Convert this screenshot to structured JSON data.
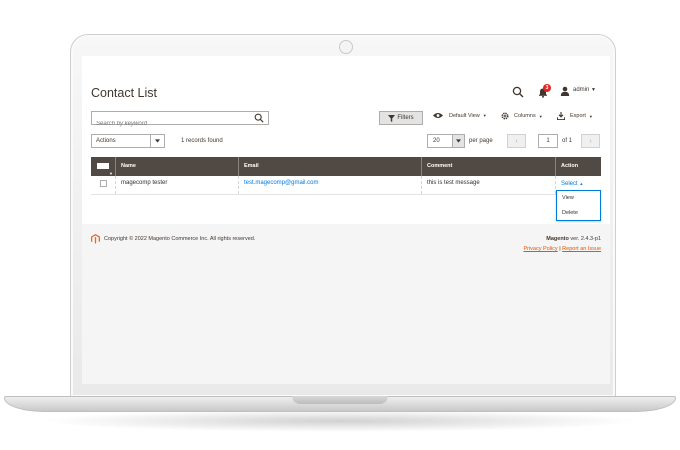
{
  "header": {
    "page_title": "Contact List",
    "user_label": "admin",
    "notification_count": "3"
  },
  "toolbar": {
    "search_placeholder": "Search by keyword",
    "filters_label": "Filters",
    "view_label": "Default View",
    "columns_label": "Columns",
    "export_label": "Export",
    "actions_label": "Actions",
    "records_found": "1 records found",
    "per_page_value": "20",
    "per_page_label": "per page",
    "page_current": "1",
    "page_of": "of 1"
  },
  "grid": {
    "columns": [
      "Name",
      "Email",
      "Comment",
      "Action"
    ],
    "rows": [
      {
        "name": "magecomp tester",
        "email": "test.magecomp@gmail.com",
        "comment": "this is test message",
        "action": "Select"
      }
    ],
    "action_menu": [
      "View",
      "Delete"
    ]
  },
  "footer": {
    "copyright": "Copyright © 2022 Magento Commerce Inc. All rights reserved.",
    "brand": "Magento",
    "version": "ver. 2.4.3-p1",
    "privacy_link": "Privacy Policy",
    "separator": "|",
    "report_link": "Report an Issue"
  },
  "colors": {
    "grid_header": "#514943",
    "link_blue": "#007bdb",
    "footer_link": "#eb5202",
    "logo_orange": "#f26322",
    "badge_red": "#e22626"
  }
}
